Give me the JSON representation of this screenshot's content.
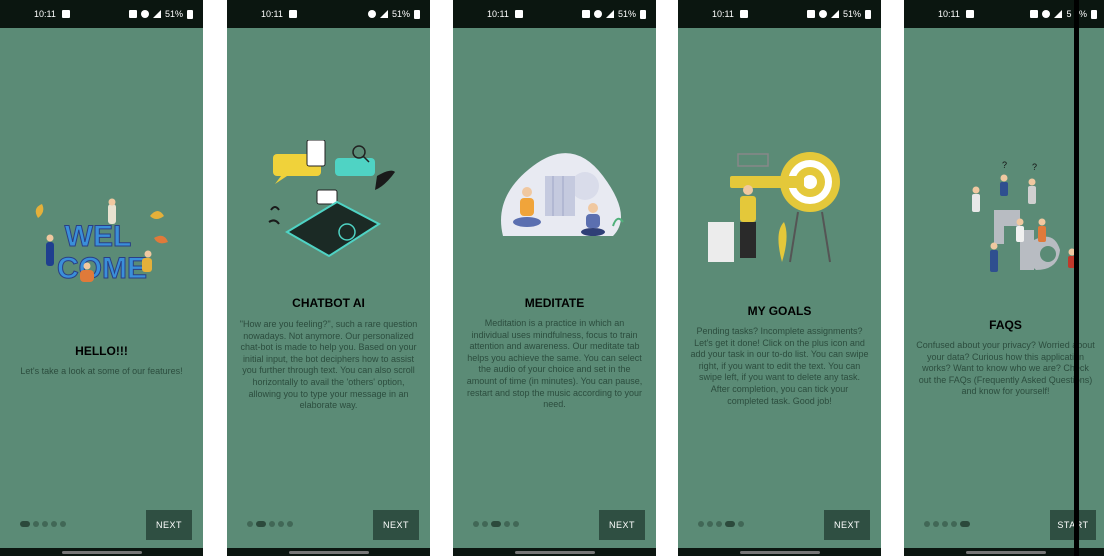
{
  "status": {
    "screens": [
      {
        "time": "10:11",
        "battery": "51%"
      },
      {
        "time": "10:11",
        "battery": "51%"
      },
      {
        "time": "10:11",
        "battery": "51%"
      },
      {
        "time": "10:11",
        "battery": "51%"
      },
      {
        "time": "10:11",
        "battery": "5 1%"
      }
    ]
  },
  "screens": [
    {
      "title": "HELLO!!!",
      "description": "Let's take a look at some of our features!",
      "button": "NEXT",
      "active_dot": 0
    },
    {
      "title": "CHATBOT AI",
      "description": "\"How are you feeling?\", such a rare question nowadays. Not anymore. Our personalized chat-bot is made to help you. Based on your initial input, the bot deciphers how to assist you further through text. You can also scroll horizontally to avail the 'others' option, allowing you to type your message in an elaborate way.",
      "button": "NEXT",
      "active_dot": 1
    },
    {
      "title": "MEDITATE",
      "description": "Meditation is a practice in which an individual uses mindfulness, focus to train attention and awareness. Our meditate tab helps you achieve the same. You can select the audio of your choice and set in the amount of time (in minutes). You can pause, restart and stop the music according to your need.",
      "button": "NEXT",
      "active_dot": 2
    },
    {
      "title": "MY GOALS",
      "description": "Pending tasks? Incomplete assignments? Let's get it done! Click on the plus icon and add your task in our to-do list. You can swipe right, if you want to edit the text. You can swipe left, if you want to delete any task. After completion, you can tick your completed task. Good job!",
      "button": "NEXT",
      "active_dot": 3
    },
    {
      "title": "FAQS",
      "description": "Confused about your privacy? Worried about your data? Curious how this application works? Want to know who we are? Check out the FAQs (Frequently Asked Questions) and know for yourself!",
      "button": "START",
      "active_dot": 4
    }
  ],
  "illustrations": [
    {
      "icon": "welcome-illustration",
      "text": "WEL COME"
    },
    {
      "icon": "chatbot-illustration"
    },
    {
      "icon": "meditate-illustration"
    },
    {
      "icon": "goals-illustration"
    },
    {
      "icon": "faq-illustration"
    }
  ],
  "colors": {
    "background": "#5b8b76",
    "button": "#2f4f42",
    "statusbar": "#0b1610",
    "title": "#000000",
    "description": "#2c4d3e"
  }
}
